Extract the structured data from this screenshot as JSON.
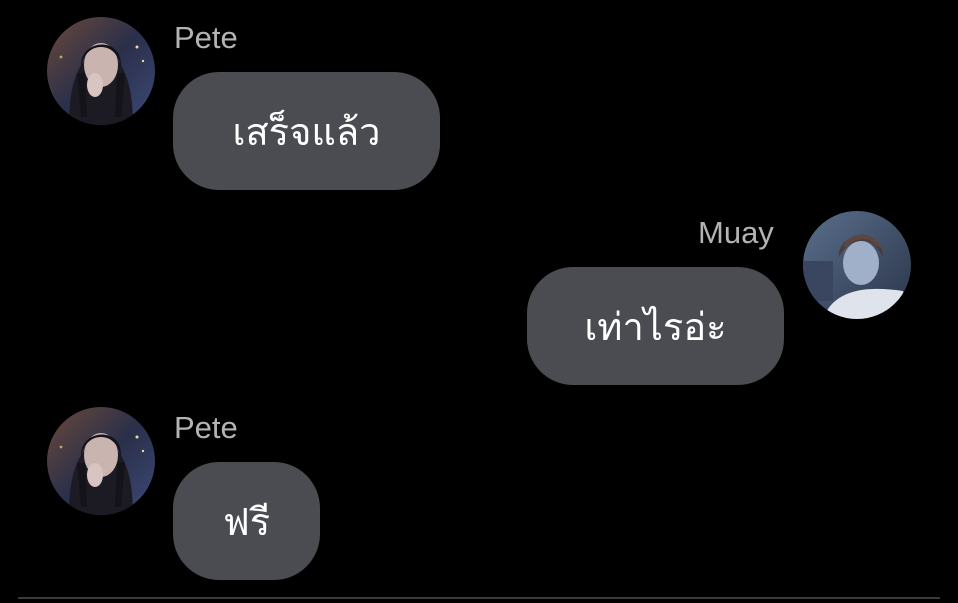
{
  "messages": [
    {
      "sender": "Pete",
      "text": "เสร็จแล้ว",
      "side": "left",
      "avatar_icon": "pete-avatar"
    },
    {
      "sender": "Muay",
      "text": "เท่าไรอ่ะ",
      "side": "right",
      "avatar_icon": "muay-avatar"
    },
    {
      "sender": "Pete",
      "text": "ฟรี",
      "side": "left",
      "avatar_icon": "pete-avatar"
    }
  ],
  "colors": {
    "background": "#000000",
    "bubble": "#4a4c52",
    "bubble_text": "#ffffff",
    "sender_name": "#b3b3b3"
  }
}
